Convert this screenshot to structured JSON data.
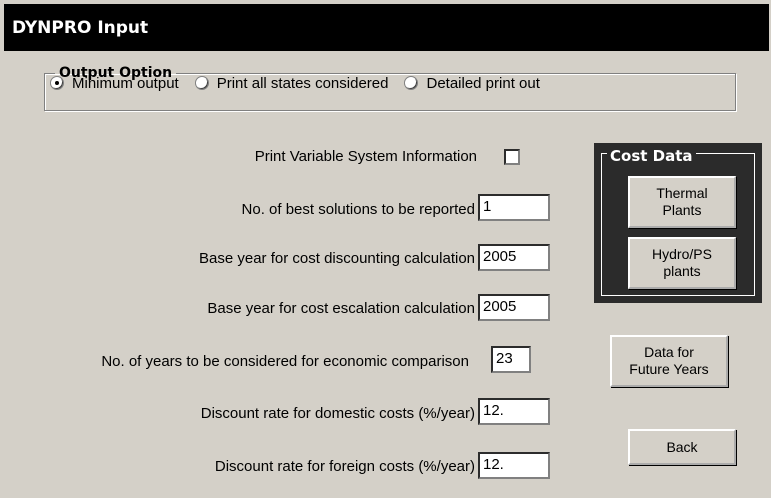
{
  "window": {
    "title": "DYNPRO Input"
  },
  "output_option": {
    "legend": "Output Option",
    "options": [
      "Minimum output",
      "Print all states considered",
      "Detailed print out"
    ],
    "selected": "Minimum output"
  },
  "form": {
    "print_variable_label": "Print Variable System Information",
    "print_variable_checked": false,
    "best_solutions_label": "No. of best solutions to be reported",
    "best_solutions_value": "1",
    "base_year_discount_label": "Base year for cost discounting calculation",
    "base_year_discount_value": "2005",
    "base_year_escalation_label": "Base year for cost escalation calculation",
    "base_year_escalation_value": "2005",
    "years_comparison_label": "No. of years to be considered for economic comparison",
    "years_comparison_value": "23",
    "domestic_rate_label": "Discount rate for domestic costs (%/year)",
    "domestic_rate_value": "12.",
    "foreign_rate_label": "Discount rate for foreign costs (%/year)",
    "foreign_rate_value": "12."
  },
  "cost_data": {
    "legend": "Cost Data",
    "thermal_label": "Thermal\nPlants",
    "hydro_label": "Hydro/PS\nplants"
  },
  "buttons": {
    "future_years_label": "Data for\nFuture Years",
    "back_label": "Back"
  }
}
